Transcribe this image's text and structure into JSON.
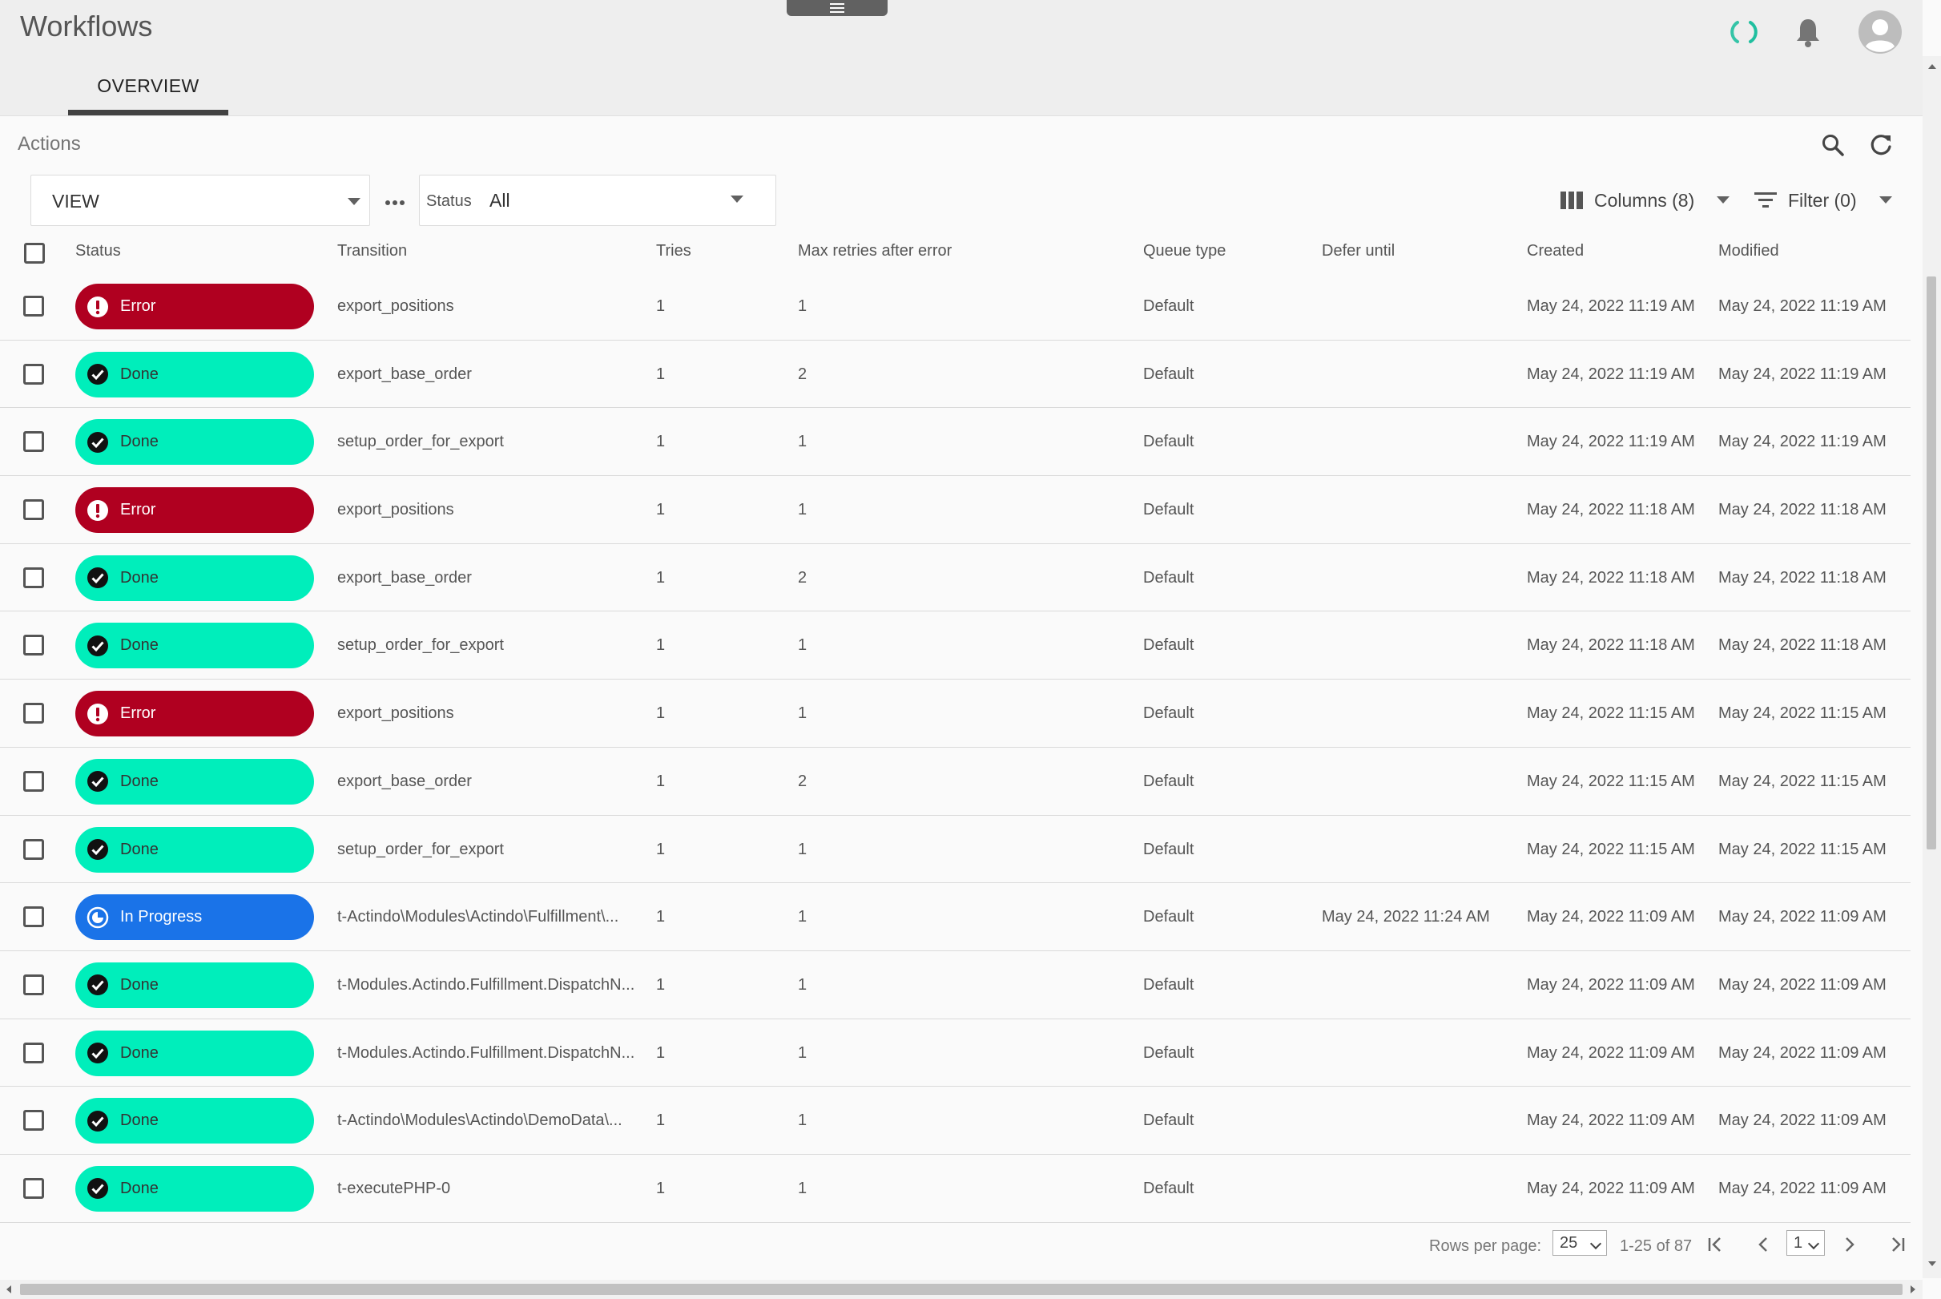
{
  "app": {
    "title": "Workflows"
  },
  "tabs": [
    {
      "label": "OVERVIEW",
      "active": true
    }
  ],
  "section": {
    "title": "Actions"
  },
  "toolbar": {
    "view_value": "VIEW",
    "status_label": "Status",
    "status_value": "All",
    "columns_label": "Columns (8)",
    "filter_label": "Filter (0)"
  },
  "columns": [
    "Status",
    "Transition",
    "Tries",
    "Max retries after error",
    "Queue type",
    "Defer until",
    "Created",
    "Modified"
  ],
  "rows": [
    {
      "status": "Error",
      "kind": "error",
      "transition": "export_positions",
      "tries": "1",
      "max_retries": "1",
      "queue": "Default",
      "defer": "",
      "created": "May 24, 2022 11:19 AM",
      "modified": "May 24, 2022 11:19 AM"
    },
    {
      "status": "Done",
      "kind": "done",
      "transition": "export_base_order",
      "tries": "1",
      "max_retries": "2",
      "queue": "Default",
      "defer": "",
      "created": "May 24, 2022 11:19 AM",
      "modified": "May 24, 2022 11:19 AM"
    },
    {
      "status": "Done",
      "kind": "done",
      "transition": "setup_order_for_export",
      "tries": "1",
      "max_retries": "1",
      "queue": "Default",
      "defer": "",
      "created": "May 24, 2022 11:19 AM",
      "modified": "May 24, 2022 11:19 AM"
    },
    {
      "status": "Error",
      "kind": "error",
      "transition": "export_positions",
      "tries": "1",
      "max_retries": "1",
      "queue": "Default",
      "defer": "",
      "created": "May 24, 2022 11:18 AM",
      "modified": "May 24, 2022 11:18 AM"
    },
    {
      "status": "Done",
      "kind": "done",
      "transition": "export_base_order",
      "tries": "1",
      "max_retries": "2",
      "queue": "Default",
      "defer": "",
      "created": "May 24, 2022 11:18 AM",
      "modified": "May 24, 2022 11:18 AM"
    },
    {
      "status": "Done",
      "kind": "done",
      "transition": "setup_order_for_export",
      "tries": "1",
      "max_retries": "1",
      "queue": "Default",
      "defer": "",
      "created": "May 24, 2022 11:18 AM",
      "modified": "May 24, 2022 11:18 AM"
    },
    {
      "status": "Error",
      "kind": "error",
      "transition": "export_positions",
      "tries": "1",
      "max_retries": "1",
      "queue": "Default",
      "defer": "",
      "created": "May 24, 2022 11:15 AM",
      "modified": "May 24, 2022 11:15 AM"
    },
    {
      "status": "Done",
      "kind": "done",
      "transition": "export_base_order",
      "tries": "1",
      "max_retries": "2",
      "queue": "Default",
      "defer": "",
      "created": "May 24, 2022 11:15 AM",
      "modified": "May 24, 2022 11:15 AM"
    },
    {
      "status": "Done",
      "kind": "done",
      "transition": "setup_order_for_export",
      "tries": "1",
      "max_retries": "1",
      "queue": "Default",
      "defer": "",
      "created": "May 24, 2022 11:15 AM",
      "modified": "May 24, 2022 11:15 AM"
    },
    {
      "status": "In Progress",
      "kind": "progress",
      "transition": "t-Actindo\\Modules\\Actindo\\Fulfillment\\...",
      "tries": "1",
      "max_retries": "1",
      "queue": "Default",
      "defer": "May 24, 2022 11:24 AM",
      "created": "May 24, 2022 11:09 AM",
      "modified": "May 24, 2022 11:09 AM"
    },
    {
      "status": "Done",
      "kind": "done",
      "transition": "t-Modules.Actindo.Fulfillment.DispatchN...",
      "tries": "1",
      "max_retries": "1",
      "queue": "Default",
      "defer": "",
      "created": "May 24, 2022 11:09 AM",
      "modified": "May 24, 2022 11:09 AM"
    },
    {
      "status": "Done",
      "kind": "done",
      "transition": "t-Modules.Actindo.Fulfillment.DispatchN...",
      "tries": "1",
      "max_retries": "1",
      "queue": "Default",
      "defer": "",
      "created": "May 24, 2022 11:09 AM",
      "modified": "May 24, 2022 11:09 AM"
    },
    {
      "status": "Done",
      "kind": "done",
      "transition": "t-Actindo\\Modules\\Actindo\\DemoData\\...",
      "tries": "1",
      "max_retries": "1",
      "queue": "Default",
      "defer": "",
      "created": "May 24, 2022 11:09 AM",
      "modified": "May 24, 2022 11:09 AM"
    },
    {
      "status": "Done",
      "kind": "done",
      "transition": "t-executePHP-0",
      "tries": "1",
      "max_retries": "1",
      "queue": "Default",
      "defer": "",
      "created": "May 24, 2022 11:09 AM",
      "modified": "May 24, 2022 11:09 AM"
    }
  ],
  "pagination": {
    "rows_per_page_label": "Rows per page:",
    "rows_per_page": "25",
    "range": "1-25 of 87",
    "page": "1"
  },
  "colors": {
    "error": "#b00020",
    "done": "#00eebb",
    "in_progress": "#1a73e8",
    "spinner": "#1fbf9f"
  },
  "icons": {
    "header": [
      "refresh-spinner-icon",
      "bell-icon",
      "user-avatar-icon"
    ],
    "tools": [
      "search-icon",
      "refresh-icon",
      "columns-icon",
      "filter-icon"
    ]
  }
}
